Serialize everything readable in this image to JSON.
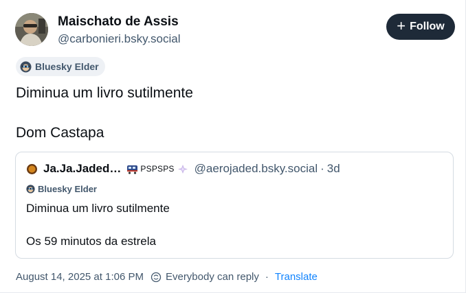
{
  "author": {
    "display_name": "Maischato de Assis",
    "handle": "@carbonieri.bsky.social",
    "badge_label": "Bluesky Elder",
    "avatar_icon": "user-avatar-photo"
  },
  "follow_button": {
    "label": "Follow",
    "icon": "plus-icon"
  },
  "post": {
    "lines": [
      "Diminua um livro sutilmente",
      "Dom Castapa"
    ]
  },
  "quoted_post": {
    "display_name": "Ja.Ja.Jaded…",
    "name_suffix": "PSPSPS",
    "handle": "@aerojaded.bsky.social",
    "separator": "·",
    "time": "3d",
    "badge_label": "Bluesky Elder",
    "lines": [
      "Diminua um livro sutilmente",
      "Os 59 minutos da estrela"
    ]
  },
  "footer": {
    "timestamp": "August 14, 2025 at 1:06 PM",
    "reply_setting": "Everybody can reply",
    "separator": "·",
    "translate_label": "Translate"
  },
  "colors": {
    "follow_bg": "#1e2a38",
    "muted_text": "#42576c",
    "link": "#1083fe",
    "badge_bg": "#eef1f5",
    "card_border": "#d4dbe2"
  }
}
